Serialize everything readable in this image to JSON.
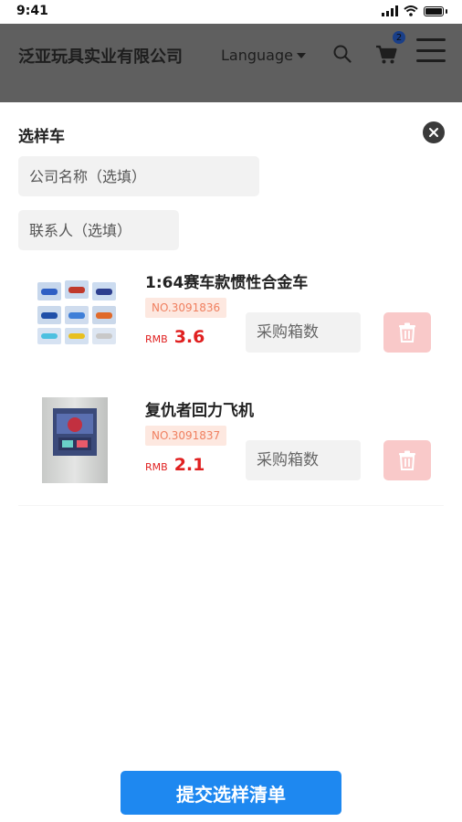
{
  "status_bar": {
    "time": "9:41"
  },
  "header": {
    "brand": "泛亚玩具实业有限公司",
    "language_label": "Language",
    "cart_count": "2"
  },
  "panel": {
    "title": "选样车",
    "company_placeholder": "公司名称（选填）",
    "contact_placeholder": "联系人（选填）",
    "items": [
      {
        "name": "1:64赛车款惯性合金车",
        "number": "NO.3091836",
        "currency": "RMB",
        "price": "3.6",
        "qty_placeholder": "采购箱数"
      },
      {
        "name": "复仇者回力飞机",
        "number": "NO.3091837",
        "currency": "RMB",
        "price": "2.1",
        "qty_placeholder": "采购箱数"
      }
    ],
    "submit_label": "提交选样清单"
  },
  "colors": {
    "accent": "#1e88f0",
    "price": "#e02020",
    "delete_bg": "#f9c9c9",
    "number_tag_bg": "#fde8e0",
    "overlay_header": "#5f5f5f"
  },
  "icons": [
    "signal-icon",
    "wifi-icon",
    "battery-icon",
    "caret-down-icon",
    "search-icon",
    "cart-icon",
    "menu-icon",
    "close-icon",
    "trash-icon"
  ]
}
